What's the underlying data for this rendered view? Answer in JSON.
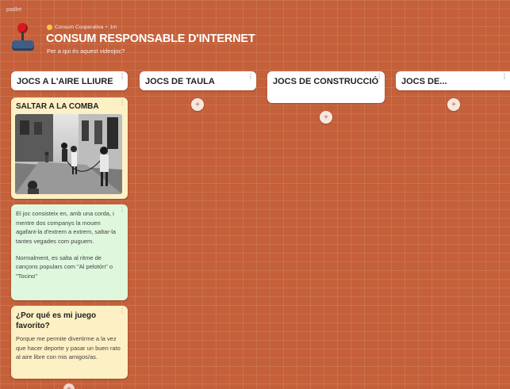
{
  "brand": "padlet",
  "header": {
    "author": "Consum Cooperativa",
    "separator": "•",
    "time": "1m",
    "title": "CONSUM RESPONSABLE D'INTERNET",
    "subtitle": "Per a qui és aquest videojoc?"
  },
  "columns": [
    {
      "title": "JOCS A L'AIRE LLIURE"
    },
    {
      "title": "JOCS DE TAULA"
    },
    {
      "title": "JOCS DE CONSTRUCCIÓ"
    },
    {
      "title": "JOCS DE..."
    }
  ],
  "add_symbol": "+",
  "menu_symbol": "⋮",
  "posts": {
    "comba": {
      "title": "SALTAR A LA COMBA"
    },
    "description": {
      "paragraph1": "El joc consisteix en, amb una corda, i mentre dos companys la mouen agafant-la d'extrem a extrem, saltar-la tantes vegades com puguem.",
      "paragraph2": "Normalment, es salta al ritme de cançons populars com \"Al pelotón\" o \"Tocino\""
    },
    "favorite": {
      "title": "¿Por qué es mi juego favorito?",
      "body": "Porque me permite divertirme a la vez que hacer deporte y pasar un buen rato al aire libre con mis amigos/as."
    }
  },
  "colors": {
    "background": "#c4603a",
    "card_yellow": "#fdf0c4",
    "card_green": "#dff7dd",
    "avatar_red": "#d8191f"
  }
}
